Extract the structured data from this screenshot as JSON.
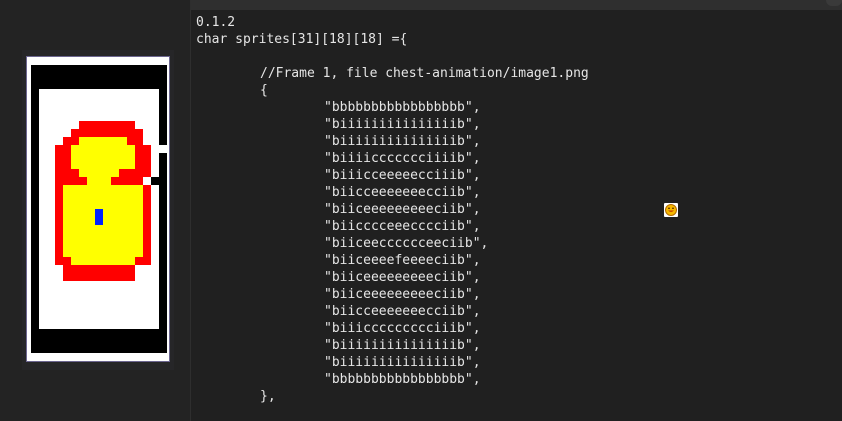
{
  "version_label": "0.1.2",
  "code": {
    "declaration": "char sprites[31][18][18] ={",
    "comment": "//Frame 1, file chest-animation/image1.png",
    "open_brace": "{",
    "rows": [
      "\"bbbbbbbbbbbbbbbbb\",",
      "\"biiiiiiiiiiiiiiib\",",
      "\"biiiiiiiiiiiiiiib\",",
      "\"biiiiccccccciiiib\",",
      "\"biiicceeeeecciiib\",",
      "\"biicceeeeeeecciib\",",
      "\"biiceeeeeeeeeciib\",",
      "\"biicccceeecccciib\",",
      "\"biiceecccccceeciib\",",
      "\"biiceeeefeeeeciib\",",
      "\"biiceeeeeeeeeciib\",",
      "\"biiceeeeeeeeeciib\",",
      "\"biicceeeeeeecciib\",",
      "\"biiiccccccccciiib\",",
      "\"biiiiiiiiiiiiiiib\",",
      "\"biiiiiiiiiiiiiiib\",",
      "\"bbbbbbbbbbbbbbbbb\","
    ],
    "close_brace": "},"
  },
  "preview": {
    "colors": {
      "b": "#000000",
      "i": "#ffffff",
      "c": "#ff0000",
      "e": "#ffff00",
      "f": "#0022ff"
    }
  },
  "icons": {
    "emoji": "smiley-emoji-icon"
  }
}
